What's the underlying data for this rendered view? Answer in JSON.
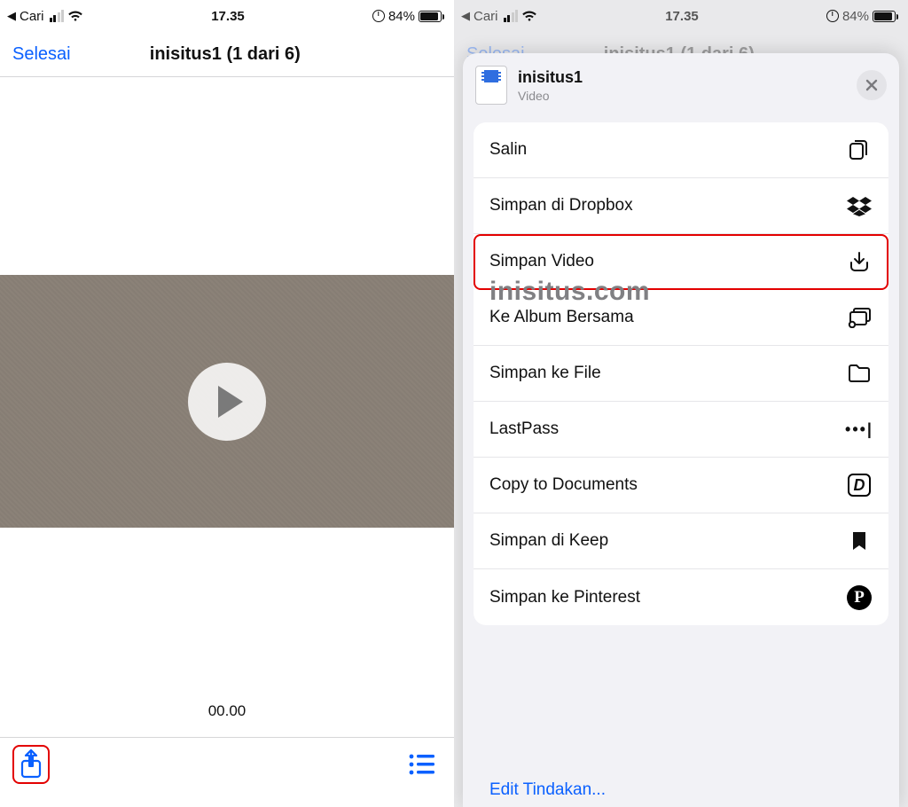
{
  "status": {
    "back_app": "Cari",
    "time": "17.35",
    "battery_pct": "84%"
  },
  "left": {
    "done": "Selesai",
    "title": "inisitus1 (1 dari 6)",
    "timecode": "00.00"
  },
  "right": {
    "done": "Selesai",
    "title_hidden": "inisitus1 (1 dari 6)",
    "sheet": {
      "file_name": "inisitus1",
      "file_type": "Video",
      "actions": [
        {
          "label": "Salin",
          "icon": "copy-icon"
        },
        {
          "label": "Simpan di Dropbox",
          "icon": "dropbox-icon"
        },
        {
          "label": "Simpan Video",
          "icon": "download-icon",
          "highlight": true
        },
        {
          "label": "Ke Album Bersama",
          "icon": "shared-album-icon"
        },
        {
          "label": "Simpan ke File",
          "icon": "folder-icon"
        },
        {
          "label": "LastPass",
          "icon": "lastpass-icon"
        },
        {
          "label": "Copy to Documents",
          "icon": "documents-icon"
        },
        {
          "label": "Simpan di Keep",
          "icon": "bookmark-icon"
        },
        {
          "label": "Simpan ke Pinterest",
          "icon": "pinterest-icon"
        }
      ],
      "edit": "Edit Tindakan..."
    }
  },
  "watermark": "inisitus.com"
}
